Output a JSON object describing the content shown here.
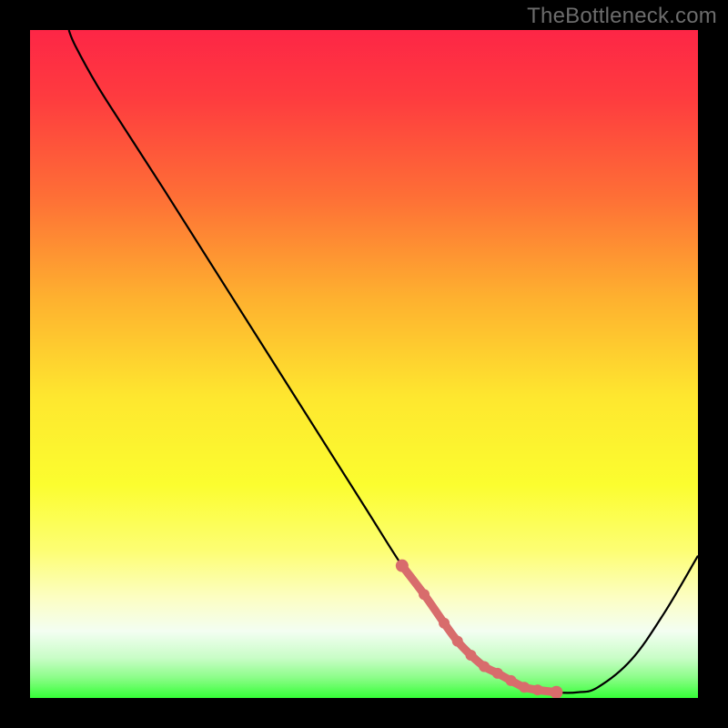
{
  "watermark": "TheBottleneck.com",
  "chart_data": {
    "type": "line",
    "title": "",
    "xlabel": "",
    "ylabel": "",
    "xlim": [
      0,
      1
    ],
    "ylim": [
      0,
      1
    ],
    "grid": false,
    "legend": false,
    "series": [
      {
        "name": "curve",
        "color": "#000000",
        "x": [
          0.058,
          0.068,
          0.1,
          0.14,
          0.2,
          0.3,
          0.4,
          0.5,
          0.557,
          0.6,
          0.65,
          0.7,
          0.74,
          0.788,
          0.82,
          0.85,
          0.9,
          0.95,
          1.0
        ],
        "y": [
          1.0,
          0.976,
          0.918,
          0.855,
          0.762,
          0.604,
          0.446,
          0.288,
          0.198,
          0.14,
          0.08,
          0.037,
          0.016,
          0.0085,
          0.0085,
          0.016,
          0.057,
          0.128,
          0.213
        ]
      },
      {
        "name": "highlight-band",
        "color": "#d86c6c",
        "type": "scatter",
        "x": [
          0.557,
          0.59,
          0.62,
          0.64,
          0.66,
          0.68,
          0.7,
          0.72,
          0.74,
          0.76,
          0.788
        ],
        "y": [
          0.198,
          0.155,
          0.112,
          0.085,
          0.064,
          0.047,
          0.037,
          0.026,
          0.016,
          0.012,
          0.0085
        ]
      }
    ],
    "gradient_stops": [
      {
        "offset": 0.0,
        "color": "#fd2646"
      },
      {
        "offset": 0.1,
        "color": "#fe3b3f"
      },
      {
        "offset": 0.25,
        "color": "#fe6f36"
      },
      {
        "offset": 0.4,
        "color": "#feb02f"
      },
      {
        "offset": 0.55,
        "color": "#fee72f"
      },
      {
        "offset": 0.68,
        "color": "#fbfd2f"
      },
      {
        "offset": 0.78,
        "color": "#fdfe74"
      },
      {
        "offset": 0.85,
        "color": "#fcfec3"
      },
      {
        "offset": 0.9,
        "color": "#f3fef2"
      },
      {
        "offset": 0.94,
        "color": "#c9fdc7"
      },
      {
        "offset": 0.97,
        "color": "#8bfd88"
      },
      {
        "offset": 1.0,
        "color": "#35fe37"
      }
    ],
    "highlight_style": {
      "stroke": "#d86c6c",
      "stroke_width": 9,
      "dot_radius": 6,
      "end_dot_radius": 7
    }
  }
}
